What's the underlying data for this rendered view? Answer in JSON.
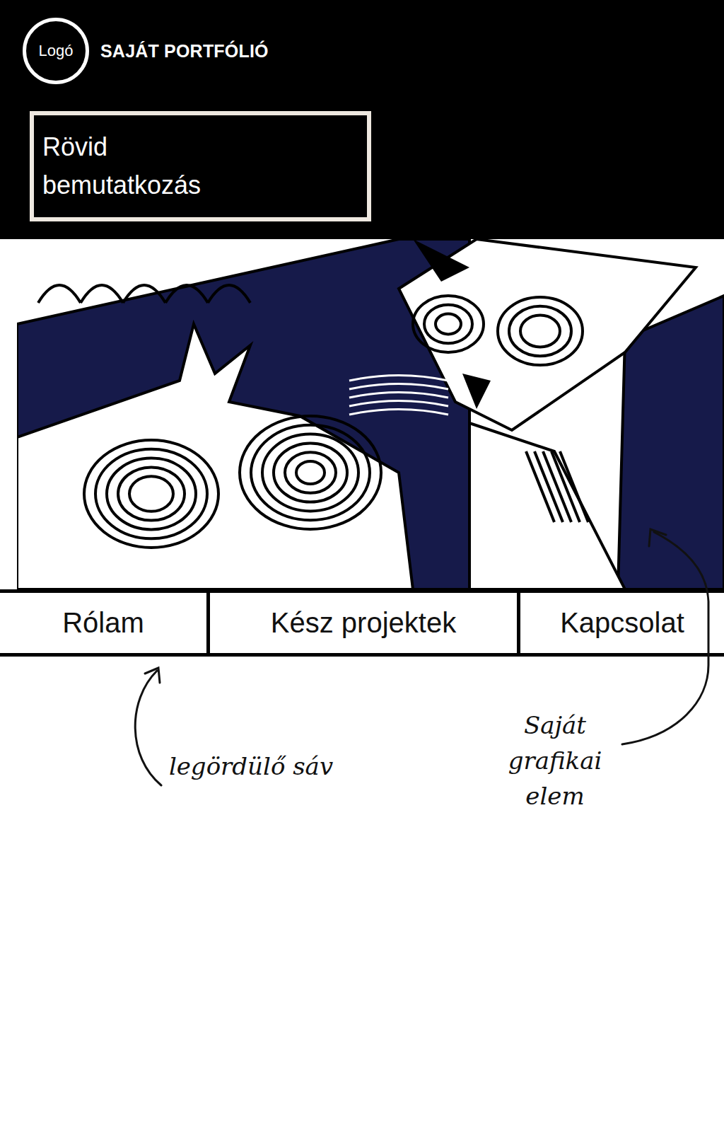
{
  "header": {
    "logo": "Logó",
    "title": "SAJÁT PORTFÓLIÓ",
    "intro": "Rövid bemutatkozás"
  },
  "nav": [
    {
      "label": "Rólam"
    },
    {
      "label": "Kész projektek"
    },
    {
      "label": "Kapcsolat"
    }
  ],
  "annotations": [
    {
      "text": "legördülő sáv"
    },
    {
      "text": "Saját grafikai elem"
    }
  ]
}
